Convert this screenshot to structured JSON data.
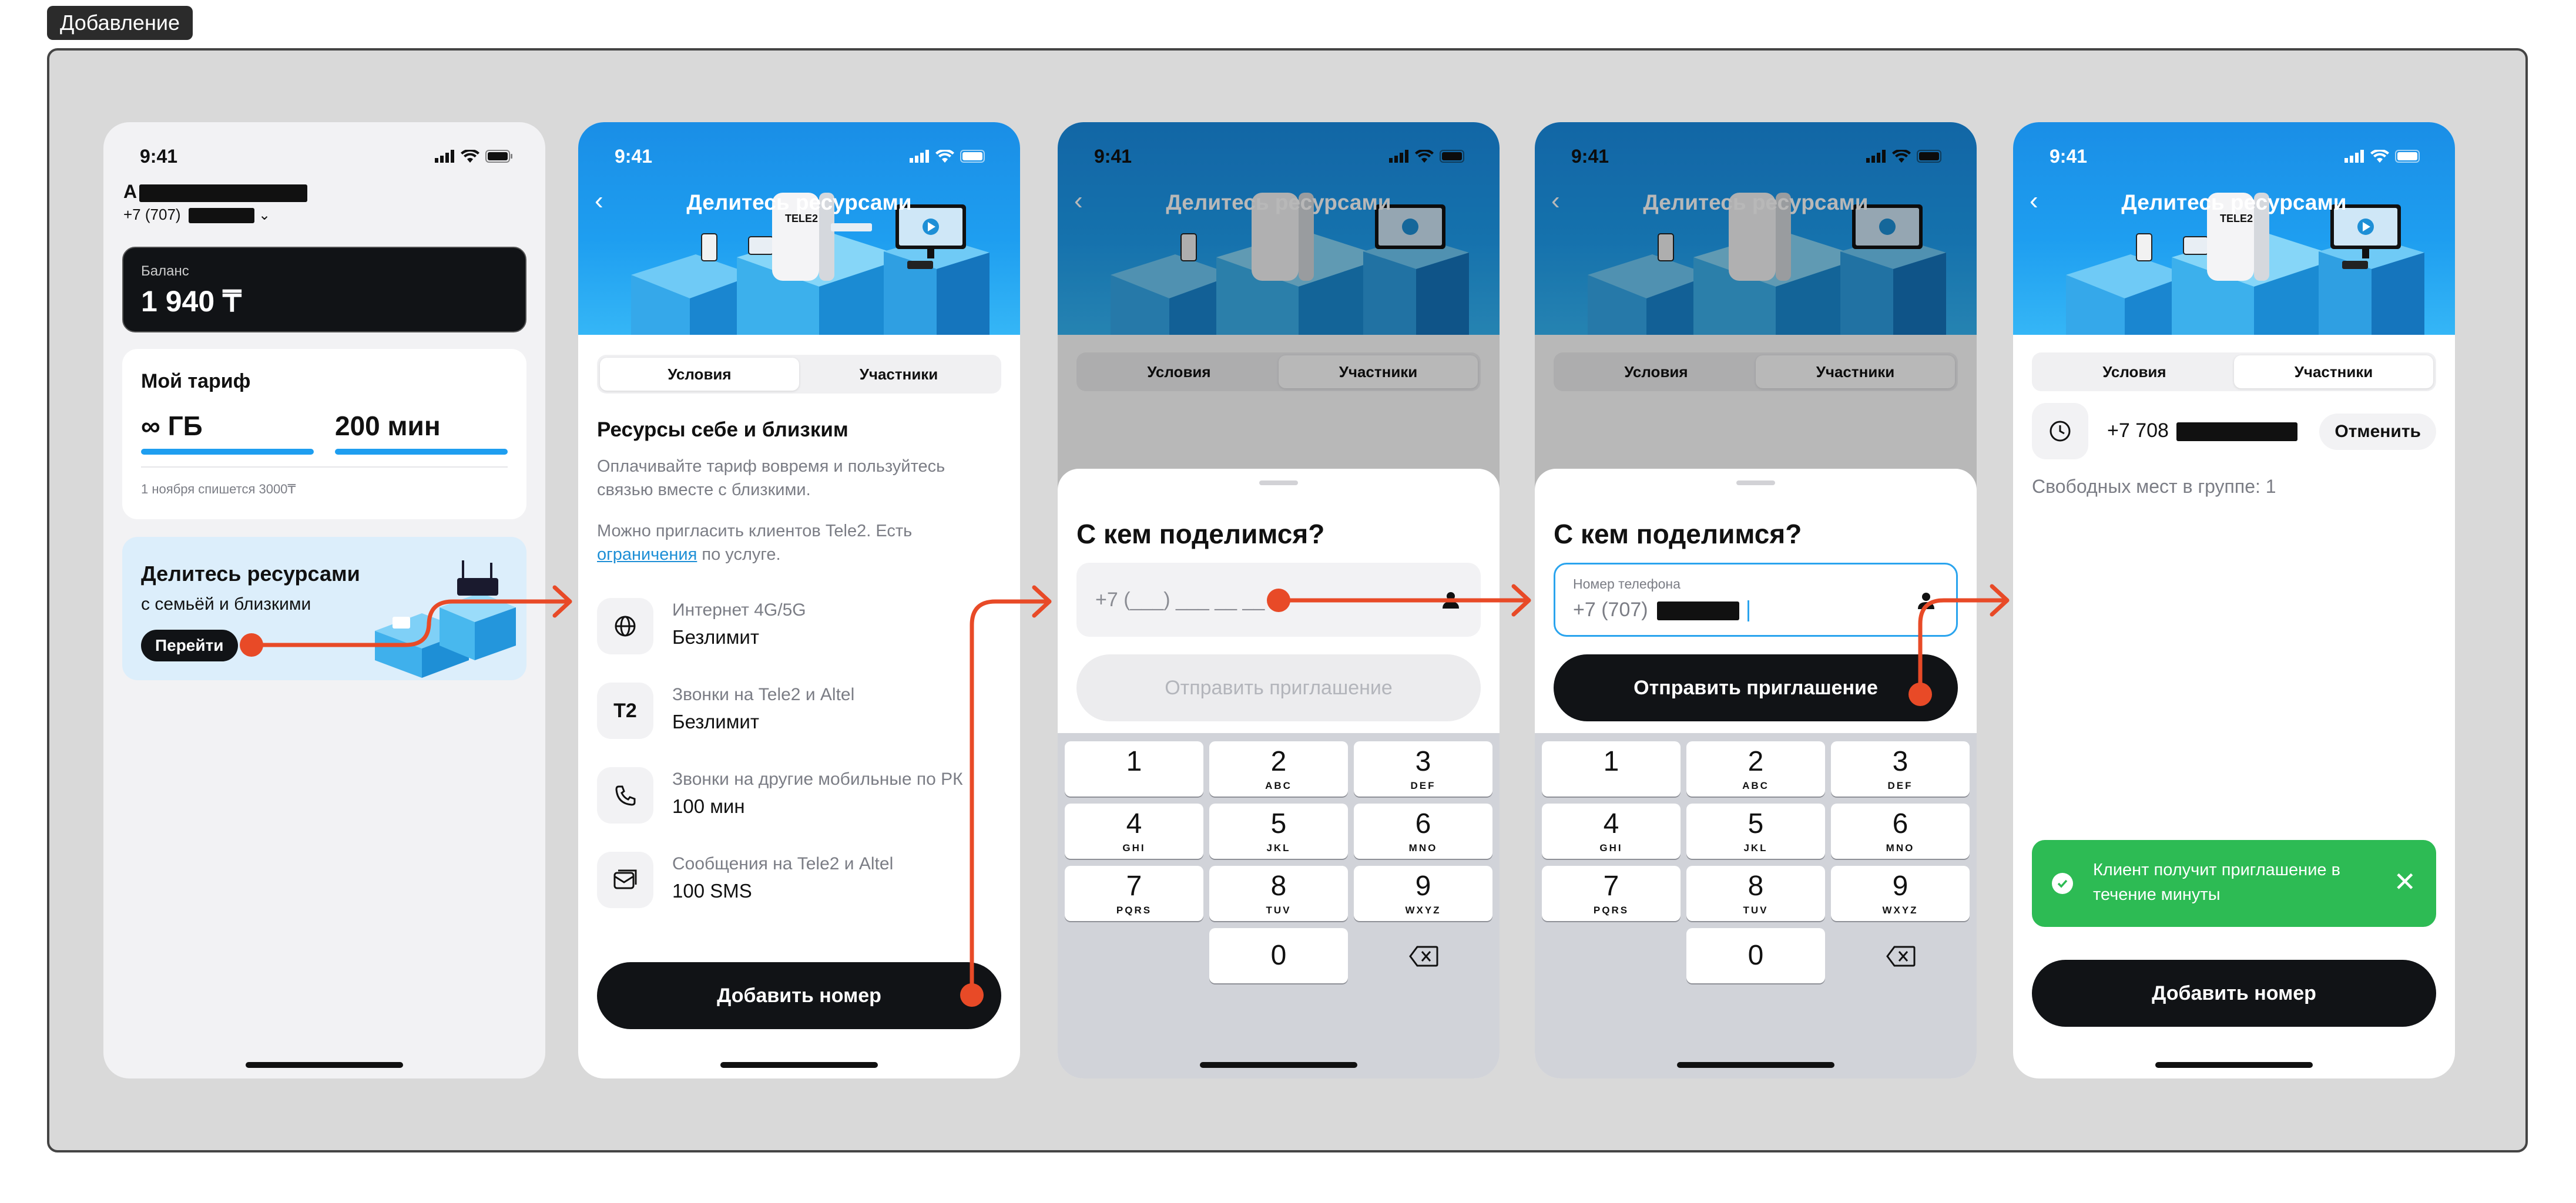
{
  "frame_label": "Добавление",
  "status_time": "9:41",
  "hero_title": "Делитесь ресурсами",
  "screen1": {
    "name_initial": "А",
    "phone_prefix": "+7 (707)",
    "balance_label": "Баланс",
    "balance_value": "1 940 ₸",
    "tariff_title": "Мой тариф",
    "tariff_gb": "∞ ГБ",
    "tariff_min": "200 мин",
    "tariff_note": "1 ноября спишется 3000₸",
    "promo_title": "Делитесь ресурсами",
    "promo_sub": "с семьёй и близкими",
    "promo_button": "Перейти"
  },
  "tabs": {
    "conditions": "Условия",
    "members": "Участники"
  },
  "screen2": {
    "heading": "Ресурсы себе и близким",
    "desc1": "Оплачивайте тариф вовремя и пользуйтесь связью вместе с близкими.",
    "desc2_pre": "Можно пригласить клиентов Tele2. Есть ",
    "desc2_link": "ограничения",
    "desc2_post": " по услуге.",
    "features": [
      {
        "icon": "globe-icon",
        "title": "Интернет 4G/5G",
        "value": "Безлимит"
      },
      {
        "icon": "tele2-icon",
        "icon_text": "T2",
        "title": "Звонки на Tele2 и Altel",
        "value": "Безлимит"
      },
      {
        "icon": "phone-call-icon",
        "title": "Звонки на другие мобильные по РК",
        "value": "100 мин"
      },
      {
        "icon": "message-icon",
        "title": "Сообщения на Tele2 и Altel",
        "value": "100 SMS"
      }
    ],
    "add_button": "Добавить номер"
  },
  "sheet": {
    "title": "С кем поделимся?",
    "phone_placeholder": "+7 (___) ___ __ __",
    "field_label": "Номер телефона",
    "field_value": "+7 (707)",
    "send_button": "Отправить приглашение"
  },
  "keypad": [
    {
      "digit": "1",
      "letters": ""
    },
    {
      "digit": "2",
      "letters": "ABC"
    },
    {
      "digit": "3",
      "letters": "DEF"
    },
    {
      "digit": "4",
      "letters": "GHI"
    },
    {
      "digit": "5",
      "letters": "JKL"
    },
    {
      "digit": "6",
      "letters": "MNO"
    },
    {
      "digit": "7",
      "letters": "PQRS"
    },
    {
      "digit": "8",
      "letters": "TUV"
    },
    {
      "digit": "9",
      "letters": "WXYZ"
    },
    {
      "digit": "0",
      "letters": ""
    }
  ],
  "screen5": {
    "member_phone": "+7 708",
    "cancel_button": "Отменить",
    "free_slots": "Свободных мест в группе: 1",
    "toast": "Клиент получит приглашение в течение минуты",
    "add_button": "Добавить номер"
  },
  "colors": {
    "accent_blue": "#1e9ef0",
    "arrow": "#e84a27",
    "toast_green": "#2dbb54",
    "dark": "#111316"
  }
}
